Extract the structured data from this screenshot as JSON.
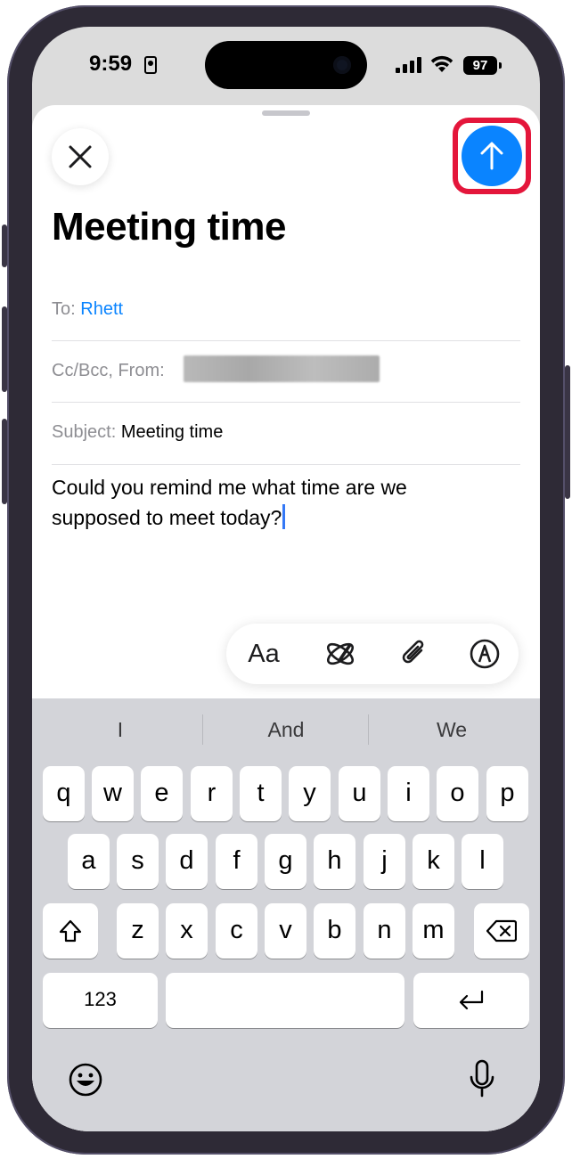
{
  "status_bar": {
    "time": "9:59",
    "battery": "97"
  },
  "compose": {
    "title": "Meeting time",
    "to_label": "To:",
    "to_value": "Rhett",
    "ccbcc_label": "Cc/Bcc, From:",
    "subject_label": "Subject:",
    "subject_value": "Meeting time",
    "body": "Could you remind me what time are we supposed to meet today?"
  },
  "toolbar": {
    "format_label": "Aa"
  },
  "keyboard": {
    "suggestions": [
      "I",
      "And",
      "We"
    ],
    "row1": [
      "q",
      "w",
      "e",
      "r",
      "t",
      "y",
      "u",
      "i",
      "o",
      "p"
    ],
    "row2": [
      "a",
      "s",
      "d",
      "f",
      "g",
      "h",
      "j",
      "k",
      "l"
    ],
    "row3": [
      "z",
      "x",
      "c",
      "v",
      "b",
      "n",
      "m"
    ],
    "numbers_label": "123"
  },
  "colors": {
    "accent": "#0a84ff",
    "highlight": "#e4163b"
  },
  "icons": [
    "close-icon",
    "send-arrow-icon",
    "format-icon",
    "writing-tools-icon",
    "paperclip-icon",
    "markup-icon",
    "shift-icon",
    "delete-icon",
    "return-icon",
    "emoji-icon",
    "microphone-icon"
  ]
}
